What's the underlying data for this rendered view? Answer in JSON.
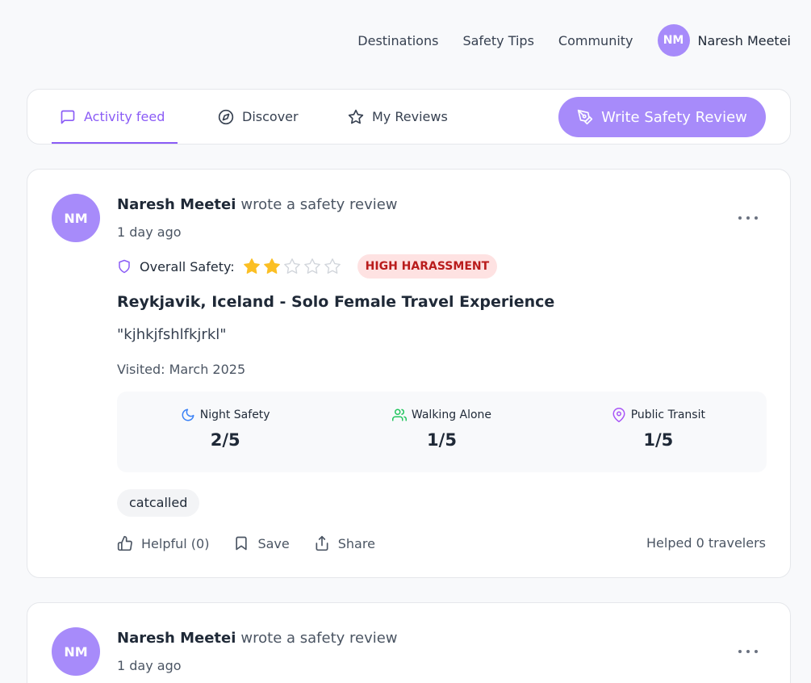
{
  "nav": {
    "links": [
      "Destinations",
      "Safety Tips",
      "Community"
    ],
    "user_initials": "NM",
    "user_name": "Naresh Meetei"
  },
  "tabs": {
    "activity": "Activity feed",
    "discover": "Discover",
    "reviews": "My Reviews",
    "write_button": "Write Safety Review"
  },
  "posts": [
    {
      "initials": "NM",
      "author": "Naresh Meetei",
      "action": "wrote a safety review",
      "time": "1 day ago",
      "overall_label": "Overall Safety:",
      "overall_rating": 2,
      "max_rating": 5,
      "badge": "HIGH HARASSMENT",
      "title": "Reykjavik, Iceland - Solo Female Travel Experience",
      "quote": "\"kjhkjfshlfkjrkl\"",
      "visited": "Visited: March 2025",
      "metrics": [
        {
          "label": "Night Safety",
          "value": "2/5",
          "icon": "moon-icon"
        },
        {
          "label": "Walking Alone",
          "value": "1/5",
          "icon": "users-icon"
        },
        {
          "label": "Public Transit",
          "value": "1/5",
          "icon": "map-pin-icon"
        }
      ],
      "tag": "catcalled",
      "helpful": "Helpful (0)",
      "save": "Save",
      "share": "Share",
      "helped": "Helped 0 travelers"
    },
    {
      "initials": "NM",
      "author": "Naresh Meetei",
      "action": "wrote a safety review",
      "time": "1 day ago"
    }
  ],
  "colors": {
    "accent": "#8b5cf6",
    "accent_light": "#a78bfa",
    "star": "#fbbf24",
    "badge_bg": "#fee2e2",
    "badge_text": "#b91c1c"
  }
}
